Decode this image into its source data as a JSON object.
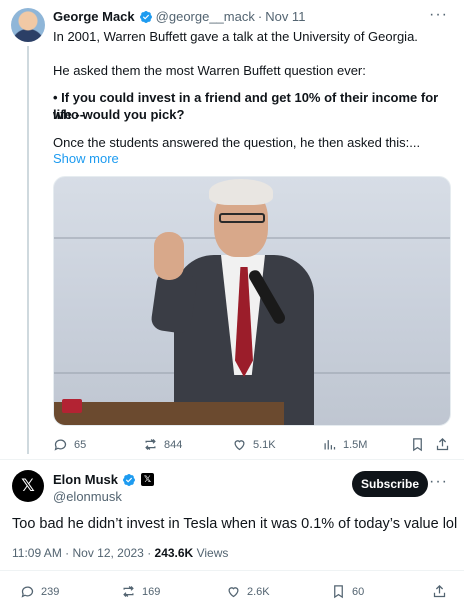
{
  "parent_tweet": {
    "author_name": "George Mack",
    "author_handle": "@george__mack",
    "separator": "·",
    "date": "Nov 11",
    "paragraph1": "In 2001, Warren Buffett gave a talk at the University of Georgia.",
    "paragraph2": "He asked them the most Warren Buffett question ever:",
    "bullet_line1": "• If you could invest in a friend and get 10% of their income for life --",
    "bullet_line2": "who would you pick?",
    "paragraph3": "Once the students answered the question, he then asked this:...",
    "show_more": "Show more",
    "stats": {
      "replies": "65",
      "reposts": "844",
      "likes": "5.1K",
      "views": "1.5M"
    }
  },
  "main_tweet": {
    "author_name": "Elon Musk",
    "author_handle": "@elonmusk",
    "subscribe_label": "Subscribe",
    "text": "Too bad he didn’t invest in Tesla when it was 0.1% of today’s value lol",
    "timestamp": "11:09 AM · Nov 12, 2023 · ",
    "views_count": "243.6K",
    "views_label": " Views",
    "stats": {
      "replies": "239",
      "reposts": "169",
      "likes": "2.6K",
      "bookmarks": "60"
    }
  },
  "colors": {
    "accent": "#1d9bf0",
    "text": "#0f1419",
    "muted": "#536471",
    "verified": "#1d9bf0"
  }
}
